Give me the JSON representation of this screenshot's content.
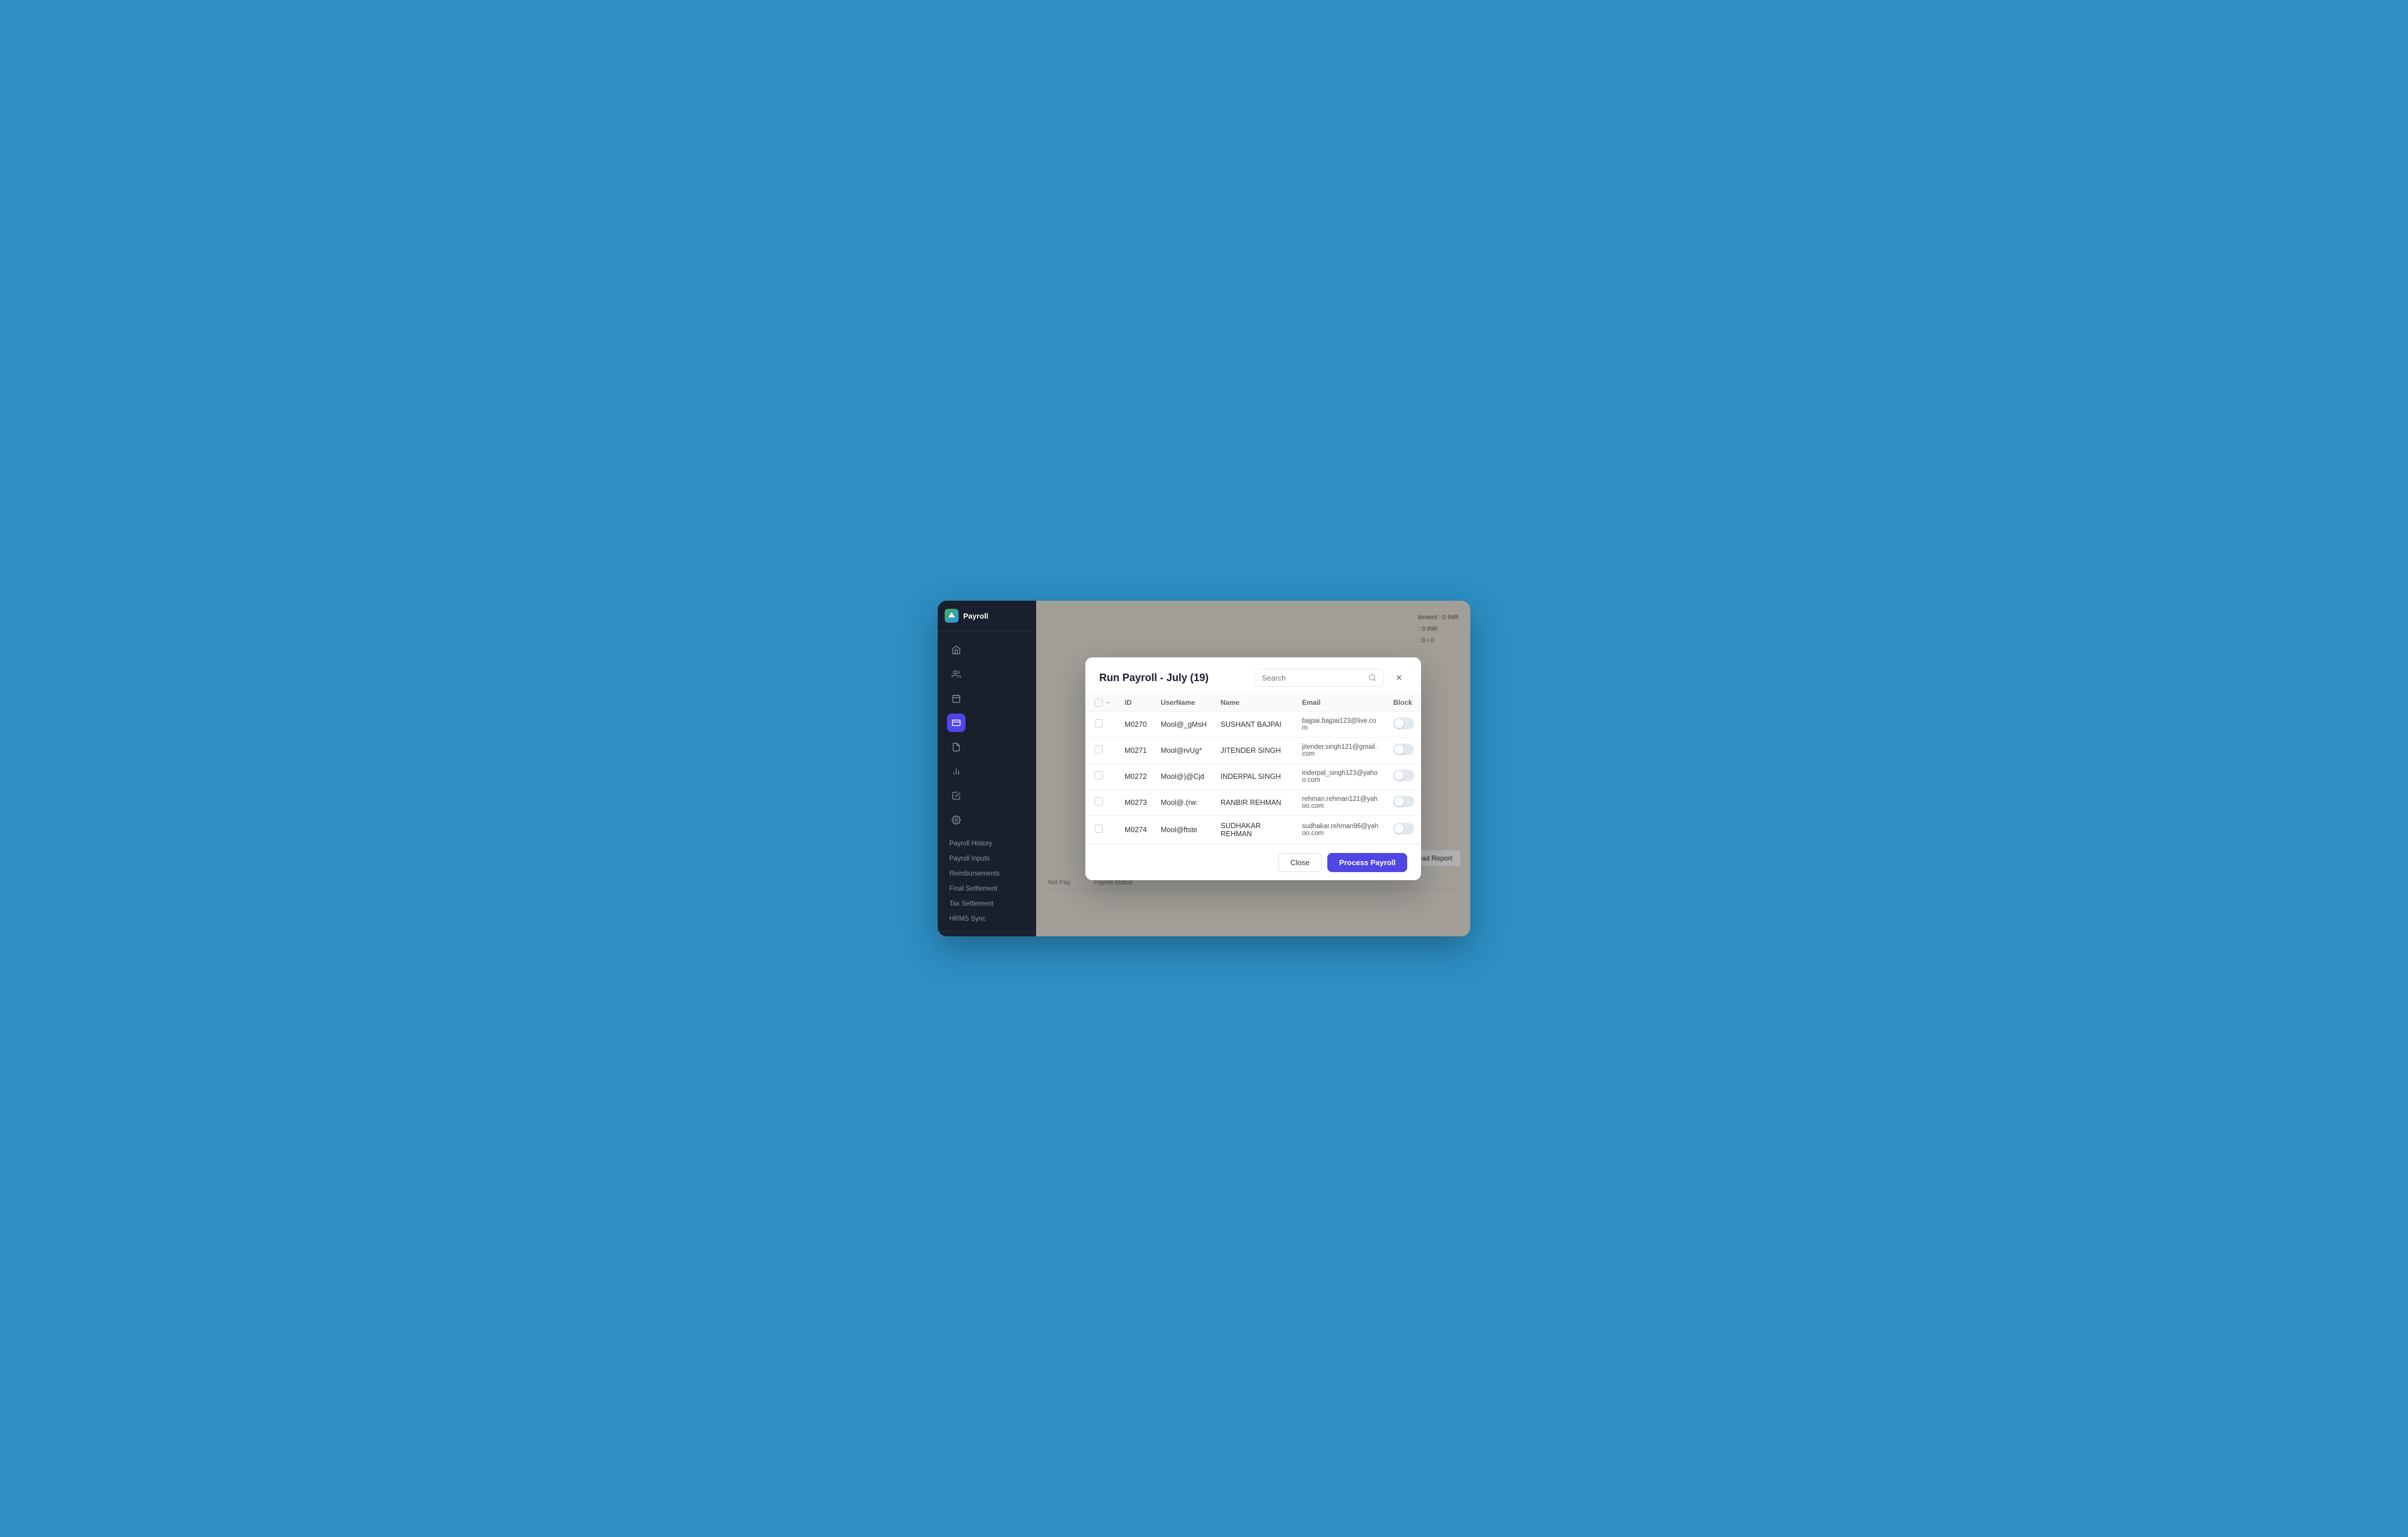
{
  "app": {
    "title": "Payroll"
  },
  "sidebar": {
    "logo_alt": "app-logo",
    "sections": [
      {
        "icon": "home-icon",
        "label": "Home"
      },
      {
        "icon": "people-icon",
        "label": "People"
      },
      {
        "icon": "calendar-icon",
        "label": "Calendar"
      },
      {
        "icon": "payroll-icon",
        "label": "Payroll",
        "active": true
      },
      {
        "icon": "document-icon",
        "label": "Documents"
      },
      {
        "icon": "reports-icon",
        "label": "Reports"
      },
      {
        "icon": "checklist-icon",
        "label": "Checklist"
      },
      {
        "icon": "settings-icon",
        "label": "Settings"
      }
    ],
    "submenu": [
      {
        "label": "Payroll History",
        "active": false
      },
      {
        "label": "Payroll Inputs",
        "active": false
      },
      {
        "label": "Reimbursements",
        "active": false
      },
      {
        "label": "Final Settlement",
        "active": false
      },
      {
        "label": "Tax Settlement",
        "active": false
      },
      {
        "label": "HRMS Sync",
        "active": false
      }
    ]
  },
  "background": {
    "stats": [
      {
        "label": "lement",
        "value": "0 INR"
      },
      {
        "label": "",
        "value": "0 INR"
      },
      {
        "label": "",
        "value": "0 / 0"
      }
    ],
    "actions": {
      "process_label": "Process Payroll",
      "download_label": "Download Report"
    },
    "table_headers": [
      "Net Pay",
      "Payroll Status"
    ]
  },
  "modal": {
    "title": "Run Payroll - July (19)",
    "search_placeholder": "Search",
    "close_label": "×",
    "table": {
      "headers": [
        "ID",
        "UserName",
        "Name",
        "Email",
        "Block"
      ],
      "rows": [
        {
          "id": "M0270",
          "username": "Mool@_gMsH",
          "name": "SUSHANT BAJPAI",
          "email": "bajpai.bajpai123@live.com",
          "blocked": false
        },
        {
          "id": "M0271",
          "username": "Mool@rvUg*",
          "name": "JITENDER SINGH",
          "email": "jitender.singh121@gmail.com",
          "blocked": false
        },
        {
          "id": "M0272",
          "username": "Mool@)@Cjd",
          "name": "INDERPAL SINGH",
          "email": "inderpal_singh123@yahoo.com",
          "blocked": false
        },
        {
          "id": "M0273",
          "username": "Mool@.(rw:",
          "name": "RANBIR REHMAN",
          "email": "rehman.rehman121@yahoo.com",
          "blocked": false
        },
        {
          "id": "M0274",
          "username": "Mool@ftste",
          "name": "SUDHAKAR REHMAN",
          "email": "sudhakar.rehman96@yahoo.com",
          "blocked": false
        }
      ]
    },
    "footer": {
      "close_label": "Close",
      "process_label": "Process Payroll"
    }
  }
}
